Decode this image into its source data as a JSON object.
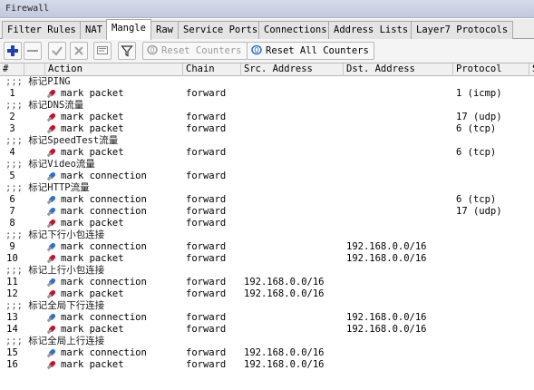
{
  "window": {
    "title": "Firewall"
  },
  "tabs": [
    {
      "label": "Filter Rules"
    },
    {
      "label": "NAT"
    },
    {
      "label": "Mangle",
      "active": true
    },
    {
      "label": "Raw"
    },
    {
      "label": "Service Ports"
    },
    {
      "label": "Connections"
    },
    {
      "label": "Address Lists"
    },
    {
      "label": "Layer7 Protocols"
    }
  ],
  "toolbar": {
    "add_icon": "plus-icon",
    "remove_icon": "minus-icon",
    "enable_icon": "check-icon",
    "disable_icon": "cross-icon",
    "comment_icon": "comment-icon",
    "filter_icon": "filter-icon",
    "reset_counters_label": "Reset Counters",
    "reset_all_counters_label": "Reset All Counters"
  },
  "columns": {
    "num": "#",
    "action": "Action",
    "chain": "Chain",
    "src": "Src. Address",
    "dst": "Dst. Address",
    "protocol": "Protocol",
    "extra": "S"
  },
  "colors": {
    "rule_icon_red": "#c8102e",
    "rule_icon_blue": "#2e6fd0"
  },
  "rows": [
    {
      "type": "comment",
      "prefix": ";;;",
      "text": "标记PING"
    },
    {
      "type": "rule",
      "num": "1",
      "icon": "red",
      "action": "mark packet",
      "chain": "forward",
      "src": "",
      "dst": "",
      "protocol": "1 (icmp)"
    },
    {
      "type": "comment",
      "prefix": ";;;",
      "text": "标记DNS流量"
    },
    {
      "type": "rule",
      "num": "2",
      "icon": "red",
      "action": "mark packet",
      "chain": "forward",
      "src": "",
      "dst": "",
      "protocol": "17 (udp)"
    },
    {
      "type": "rule",
      "num": "3",
      "icon": "red",
      "action": "mark packet",
      "chain": "forward",
      "src": "",
      "dst": "",
      "protocol": "6 (tcp)"
    },
    {
      "type": "comment",
      "prefix": ";;;",
      "text": "标记SpeedTest流量"
    },
    {
      "type": "rule",
      "num": "4",
      "icon": "red",
      "action": "mark packet",
      "chain": "forward",
      "src": "",
      "dst": "",
      "protocol": "6 (tcp)"
    },
    {
      "type": "comment",
      "prefix": ";;;",
      "text": "标记Video流量"
    },
    {
      "type": "rule",
      "num": "5",
      "icon": "blue",
      "action": "mark connection",
      "chain": "forward",
      "src": "",
      "dst": "",
      "protocol": ""
    },
    {
      "type": "comment",
      "prefix": ";;;",
      "text": "标记HTTP流量"
    },
    {
      "type": "rule",
      "num": "6",
      "icon": "blue",
      "action": "mark connection",
      "chain": "forward",
      "src": "",
      "dst": "",
      "protocol": "6 (tcp)"
    },
    {
      "type": "rule",
      "num": "7",
      "icon": "blue",
      "action": "mark connection",
      "chain": "forward",
      "src": "",
      "dst": "",
      "protocol": "17 (udp)"
    },
    {
      "type": "rule",
      "num": "8",
      "icon": "red",
      "action": "mark packet",
      "chain": "forward",
      "src": "",
      "dst": "",
      "protocol": ""
    },
    {
      "type": "comment",
      "prefix": ";;;",
      "text": "标记下行小包连接"
    },
    {
      "type": "rule",
      "num": "9",
      "icon": "blue",
      "action": "mark connection",
      "chain": "forward",
      "src": "",
      "dst": "192.168.0.0/16",
      "protocol": ""
    },
    {
      "type": "rule",
      "num": "10",
      "icon": "red",
      "action": "mark packet",
      "chain": "forward",
      "src": "",
      "dst": "192.168.0.0/16",
      "protocol": ""
    },
    {
      "type": "comment",
      "prefix": ";;;",
      "text": "标记上行小包连接"
    },
    {
      "type": "rule",
      "num": "11",
      "icon": "blue",
      "action": "mark connection",
      "chain": "forward",
      "src": "192.168.0.0/16",
      "dst": "",
      "protocol": ""
    },
    {
      "type": "rule",
      "num": "12",
      "icon": "red",
      "action": "mark packet",
      "chain": "forward",
      "src": "192.168.0.0/16",
      "dst": "",
      "protocol": ""
    },
    {
      "type": "comment",
      "prefix": ";;;",
      "text": "标记全局下行连接"
    },
    {
      "type": "rule",
      "num": "13",
      "icon": "blue",
      "action": "mark connection",
      "chain": "forward",
      "src": "",
      "dst": "192.168.0.0/16",
      "protocol": ""
    },
    {
      "type": "rule",
      "num": "14",
      "icon": "red",
      "action": "mark packet",
      "chain": "forward",
      "src": "",
      "dst": "192.168.0.0/16",
      "protocol": ""
    },
    {
      "type": "comment",
      "prefix": ";;;",
      "text": "标记全局上行连接"
    },
    {
      "type": "rule",
      "num": "15",
      "icon": "blue",
      "action": "mark connection",
      "chain": "forward",
      "src": "192.168.0.0/16",
      "dst": "",
      "protocol": ""
    },
    {
      "type": "rule",
      "num": "16",
      "icon": "red",
      "action": "mark packet",
      "chain": "forward",
      "src": "192.168.0.0/16",
      "dst": "",
      "protocol": ""
    }
  ]
}
